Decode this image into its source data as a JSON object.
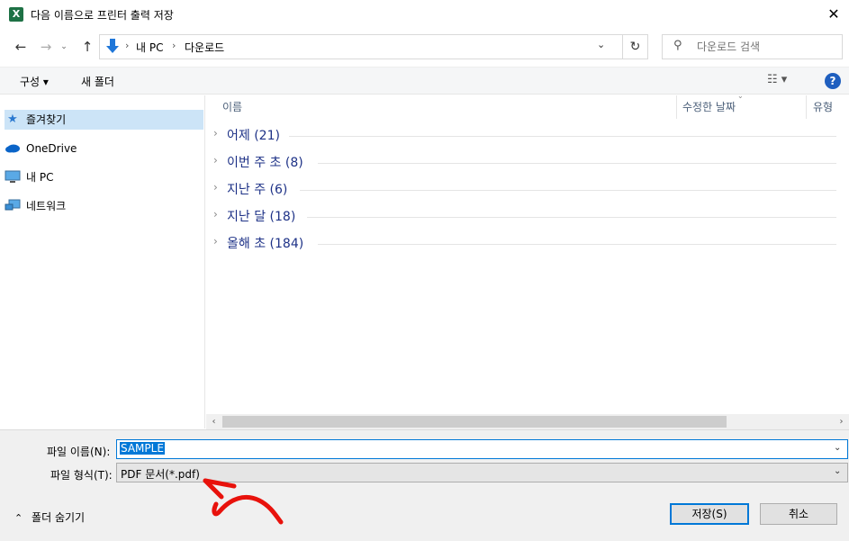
{
  "window": {
    "title": "다음 이름으로 프린터 출력 저장",
    "app_icon_letter": "X",
    "close_glyph": "✕"
  },
  "nav": {
    "path": [
      "내 PC",
      "다운로드"
    ],
    "search_placeholder": "다운로드 검색"
  },
  "toolbar": {
    "organize_label": "구성 ▾",
    "new_folder_label": "새 폴더",
    "help_label": "?"
  },
  "sidebar": {
    "items": [
      {
        "label": "즐겨찾기",
        "icon": "star-icon"
      },
      {
        "label": "OneDrive",
        "icon": "cloud-icon"
      },
      {
        "label": "내 PC",
        "icon": "computer-icon"
      },
      {
        "label": "네트워크",
        "icon": "network-icon"
      }
    ]
  },
  "columns": {
    "name": "이름",
    "date": "수정한 날짜",
    "type": "유형"
  },
  "groups": [
    {
      "label": "어제 (21)"
    },
    {
      "label": "이번 주 초 (8)"
    },
    {
      "label": "지난 주 (6)"
    },
    {
      "label": "지난 달 (18)"
    },
    {
      "label": "올해 초 (184)"
    }
  ],
  "bottom": {
    "filename_label": "파일 이름(N):",
    "filename_value": "SAMPLE",
    "filetype_label": "파일 형식(T):",
    "filetype_value": "PDF 문서(*.pdf)",
    "hide_folders_label": "폴더 숨기기",
    "save_label": "저장(S)",
    "cancel_label": "취소"
  },
  "colors": {
    "accent": "#0078d7",
    "group_text": "#1e3287",
    "annotation": "#e8120c"
  }
}
